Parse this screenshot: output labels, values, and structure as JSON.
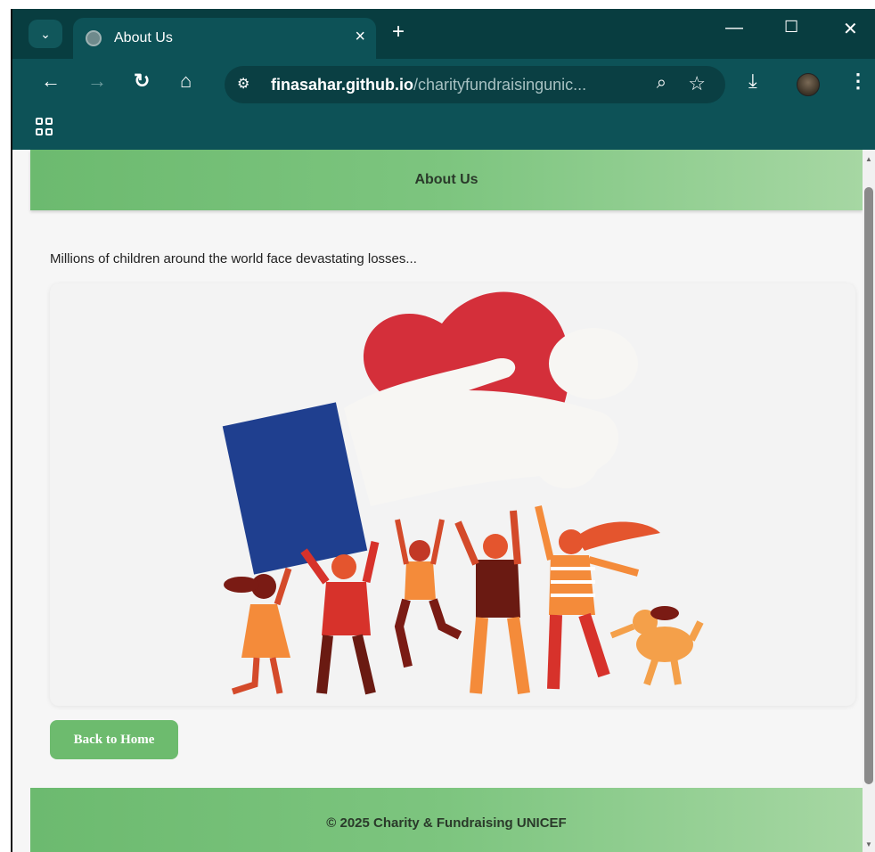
{
  "browser": {
    "tab_title": "About Us",
    "url_host": "finasahar.github.io",
    "url_path": "/charityfundraisingunic...",
    "icons": {
      "tab_search": "chevron-down-icon",
      "favicon": "globe-icon",
      "close_tab": "close-icon",
      "new_tab": "plus-icon",
      "minimize": "minimize-icon",
      "maximize": "maximize-icon",
      "close_window": "close-icon",
      "back": "arrow-left-icon",
      "forward": "arrow-right-icon",
      "reload": "reload-icon",
      "home": "home-icon",
      "site_info": "tune-icon",
      "zoom": "zoom-icon",
      "bookmark": "star-icon",
      "download": "download-icon",
      "profile": "avatar",
      "menu": "kebab-menu-icon",
      "apps": "apps-grid-icon"
    }
  },
  "page": {
    "header_title": "About Us",
    "intro_text": "Millions of children around the world face devastating losses...",
    "back_button_label": "Back to Home",
    "footer_text": "© 2025 Charity & Fundraising UNICEF"
  },
  "colors": {
    "chrome_bg": "#0d5257",
    "tabbar_bg": "#083d40",
    "accent_green": "#6dbb6e",
    "heart_red": "#d42f3a",
    "card_blue": "#1f3f8f"
  }
}
